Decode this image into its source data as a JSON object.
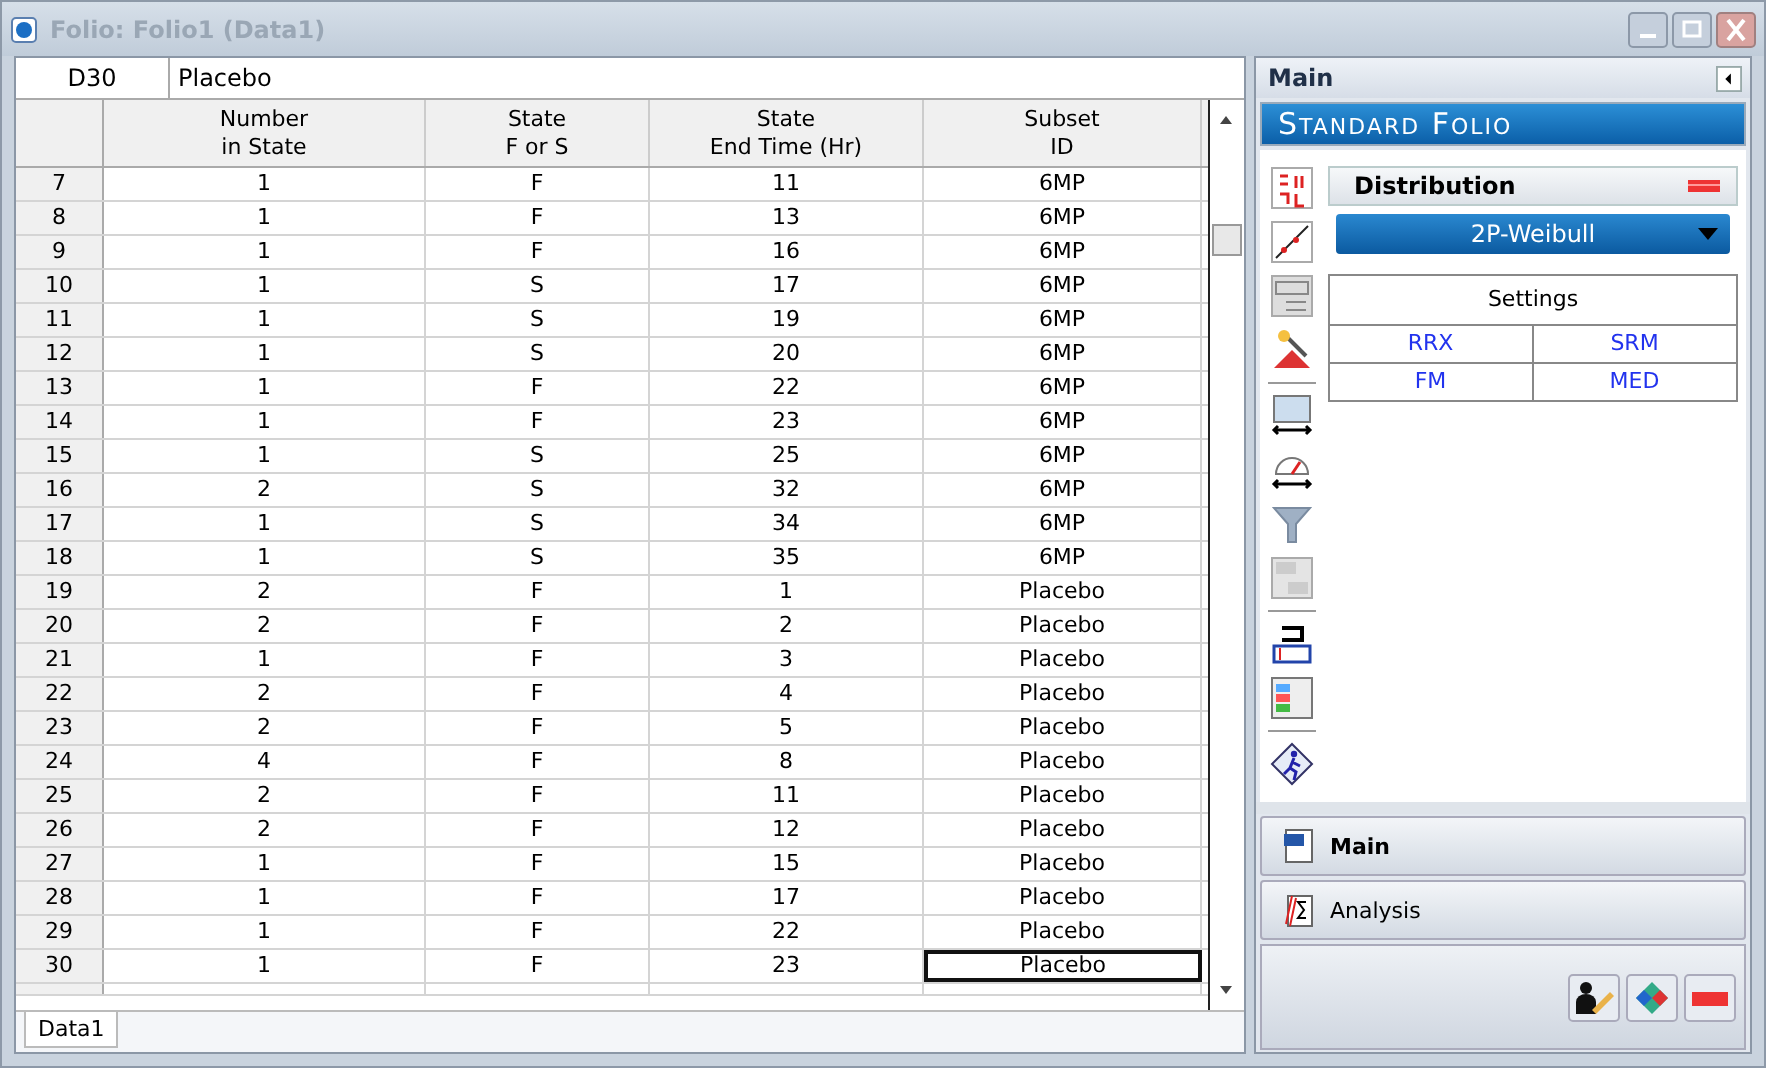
{
  "window": {
    "title": "Folio: Folio1 (Data1)"
  },
  "formula_bar": {
    "cell": "D30",
    "value": "Placebo"
  },
  "table": {
    "columns": [
      "Number\nin State",
      "State\nF or S",
      "State\nEnd Time (Hr)",
      "Subset\nID"
    ],
    "rows": [
      {
        "row": "7",
        "cells": [
          "1",
          "F",
          "11",
          "6MP"
        ],
        "selected": false
      },
      {
        "row": "8",
        "cells": [
          "1",
          "F",
          "13",
          "6MP"
        ],
        "selected": false
      },
      {
        "row": "9",
        "cells": [
          "1",
          "F",
          "16",
          "6MP"
        ],
        "selected": false
      },
      {
        "row": "10",
        "cells": [
          "1",
          "S",
          "17",
          "6MP"
        ],
        "selected": false
      },
      {
        "row": "11",
        "cells": [
          "1",
          "S",
          "19",
          "6MP"
        ],
        "selected": false
      },
      {
        "row": "12",
        "cells": [
          "1",
          "S",
          "20",
          "6MP"
        ],
        "selected": false
      },
      {
        "row": "13",
        "cells": [
          "1",
          "F",
          "22",
          "6MP"
        ],
        "selected": false
      },
      {
        "row": "14",
        "cells": [
          "1",
          "F",
          "23",
          "6MP"
        ],
        "selected": false
      },
      {
        "row": "15",
        "cells": [
          "1",
          "S",
          "25",
          "6MP"
        ],
        "selected": false
      },
      {
        "row": "16",
        "cells": [
          "2",
          "S",
          "32",
          "6MP"
        ],
        "selected": false
      },
      {
        "row": "17",
        "cells": [
          "1",
          "S",
          "34",
          "6MP"
        ],
        "selected": false
      },
      {
        "row": "18",
        "cells": [
          "1",
          "S",
          "35",
          "6MP"
        ],
        "selected": false
      },
      {
        "row": "19",
        "cells": [
          "2",
          "F",
          "1",
          "Placebo"
        ],
        "selected": false
      },
      {
        "row": "20",
        "cells": [
          "2",
          "F",
          "2",
          "Placebo"
        ],
        "selected": false
      },
      {
        "row": "21",
        "cells": [
          "1",
          "F",
          "3",
          "Placebo"
        ],
        "selected": false
      },
      {
        "row": "22",
        "cells": [
          "2",
          "F",
          "4",
          "Placebo"
        ],
        "selected": false
      },
      {
        "row": "23",
        "cells": [
          "2",
          "F",
          "5",
          "Placebo"
        ],
        "selected": false
      },
      {
        "row": "24",
        "cells": [
          "4",
          "F",
          "8",
          "Placebo"
        ],
        "selected": false
      },
      {
        "row": "25",
        "cells": [
          "2",
          "F",
          "11",
          "Placebo"
        ],
        "selected": false
      },
      {
        "row": "26",
        "cells": [
          "2",
          "F",
          "12",
          "Placebo"
        ],
        "selected": false
      },
      {
        "row": "27",
        "cells": [
          "1",
          "F",
          "15",
          "Placebo"
        ],
        "selected": false
      },
      {
        "row": "28",
        "cells": [
          "1",
          "F",
          "17",
          "Placebo"
        ],
        "selected": false
      },
      {
        "row": "29",
        "cells": [
          "1",
          "F",
          "22",
          "Placebo"
        ],
        "selected": false
      },
      {
        "row": "30",
        "cells": [
          "1",
          "F",
          "23",
          "Placebo"
        ],
        "selected": true
      }
    ]
  },
  "sheet_tabs": [
    {
      "label": "Data1",
      "selected": true
    }
  ],
  "panel": {
    "title": "Main",
    "banner": "Standard Folio",
    "distribution_title": "Distribution",
    "distribution": "2P-Weibull",
    "settings_title": "Settings",
    "settings": [
      "RRX",
      "SRM",
      "FM",
      "MED"
    ]
  },
  "nav_buttons": [
    {
      "label": "Main",
      "selected": true
    },
    {
      "label": "Analysis",
      "selected": false
    }
  ]
}
